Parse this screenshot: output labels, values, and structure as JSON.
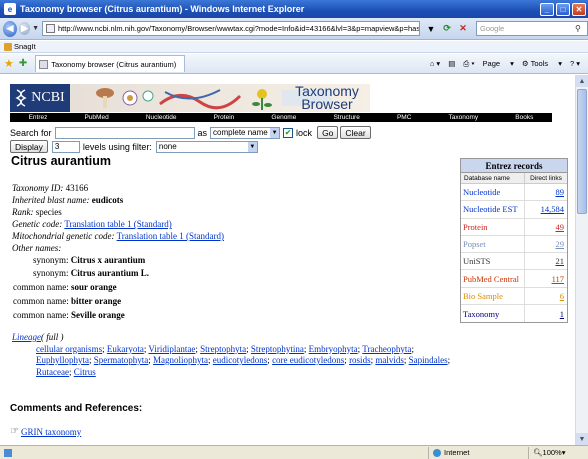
{
  "window": {
    "title": "Taxonomy browser (Citrus aurantium) - Windows Internet Explorer"
  },
  "address": {
    "url": "http://www.ncbi.nlm.nih.gov/Taxonomy/Browser/wwwtax.cgi?mode=Info&id=43166&lvl=3&p=mapview&p=has_",
    "search_placeholder": "Google"
  },
  "links_bar": {
    "snagit": "SnagIt"
  },
  "tab": {
    "title": "Taxonomy browser (Citrus aurantium)"
  },
  "toolbar": {
    "page": "Page",
    "tools": "Tools"
  },
  "banner": {
    "logo": "NCBI",
    "title": "Taxonomy Browser",
    "nav": [
      "Entrez",
      "PubMed",
      "Nucleotide",
      "Protein",
      "Genome",
      "Structure",
      "PMC",
      "Taxonomy",
      "Books"
    ]
  },
  "search": {
    "label": "Search for",
    "as_label": "as",
    "mode": "complete name",
    "lock_label": "lock",
    "go": "Go",
    "clear": "Clear",
    "display": "Display",
    "levels_value": "3",
    "levels_label": "levels using filter:",
    "filter": "none"
  },
  "species": "Citrus aurantium",
  "info": {
    "taxonomy_id_label": "Taxonomy ID:",
    "taxonomy_id": "43166",
    "blast_label": "Inherited blast name:",
    "blast_name": "eudicots",
    "rank_label": "Rank:",
    "rank": "species",
    "genetic_label": "Genetic code:",
    "genetic_code": "Translation table 1 (Standard)",
    "mito_label": "Mitochondrial genetic code:",
    "mito_code": "Translation table 1 (Standard)",
    "other_names_label": "Other names:"
  },
  "other_names": [
    {
      "type": "synonym:",
      "name": "Citrus x aurantium"
    },
    {
      "type": "synonym:",
      "name": "Citrus aurantium L."
    },
    {
      "type": "common name:",
      "name": "sour orange"
    },
    {
      "type": "common name:",
      "name": "bitter orange"
    },
    {
      "type": "common name:",
      "name": "Seville orange"
    }
  ],
  "lineage": {
    "label": "Lineage",
    "full": "( full )",
    "items": [
      "cellular organisms",
      "Eukaryota",
      "Viridiplantae",
      "Streptophyta",
      "Streptophytina",
      "Embryophyta",
      "Tracheophyta",
      "Euphyllophyta",
      "Spermatophyta",
      "Magnoliophyta",
      "eudicotyledons",
      "core eudicotyledons",
      "rosids",
      "malvids",
      "Sapindales",
      "Rutaceae",
      "Citrus"
    ]
  },
  "comments": {
    "heading": "Comments and References:",
    "grin": "GRIN taxonomy"
  },
  "entrez": {
    "heading": "Entrez records",
    "col_db": "Database name",
    "col_links": "Direct links",
    "rows": [
      {
        "db": "Nucleotide",
        "count": "89",
        "color": "#0033cc"
      },
      {
        "db": "Nucleotide EST",
        "count": "14,584",
        "color": "#0033cc"
      },
      {
        "db": "Protein",
        "count": "49",
        "color": "#cc2222"
      },
      {
        "db": "Popset",
        "count": "29",
        "color": "#7a8fb8"
      },
      {
        "db": "UniSTS",
        "count": "21",
        "color": "#333333"
      },
      {
        "db": "PubMed Central",
        "count": "117",
        "color": "#cc3300"
      },
      {
        "db": "Bio Sample",
        "count": "6",
        "color": "#d98c00"
      },
      {
        "db": "Taxonomy",
        "count": "1",
        "color": "#000080"
      }
    ]
  },
  "status": {
    "zone": "Internet",
    "zoom": "100%"
  }
}
